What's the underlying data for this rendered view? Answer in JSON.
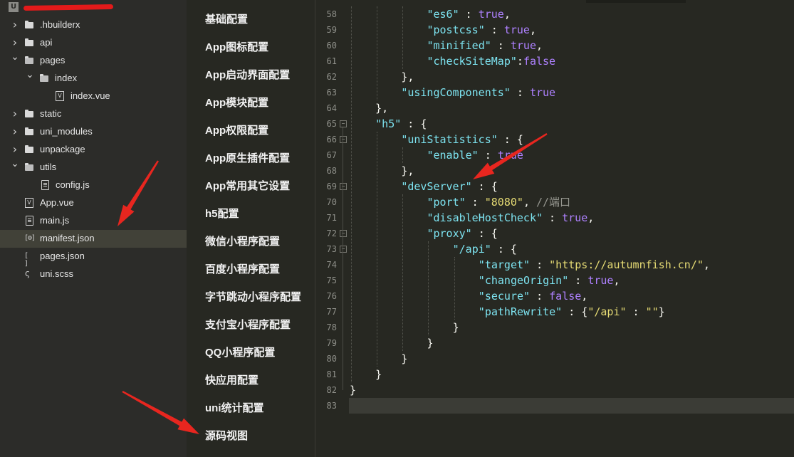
{
  "file_tree": {
    "project_icon": "U",
    "items": [
      {
        "label": ".hbuilderx",
        "type": "folder",
        "expanded": false,
        "indent": 0
      },
      {
        "label": "api",
        "type": "folder",
        "expanded": false,
        "indent": 0
      },
      {
        "label": "pages",
        "type": "folder",
        "expanded": true,
        "indent": 0
      },
      {
        "label": "index",
        "type": "folder",
        "expanded": true,
        "indent": 1
      },
      {
        "label": "index.vue",
        "type": "vue",
        "indent": 2
      },
      {
        "label": "static",
        "type": "folder",
        "expanded": false,
        "indent": 0
      },
      {
        "label": "uni_modules",
        "type": "folder",
        "expanded": false,
        "indent": 0
      },
      {
        "label": "unpackage",
        "type": "folder",
        "expanded": false,
        "indent": 0
      },
      {
        "label": "utils",
        "type": "folder",
        "expanded": true,
        "indent": 0
      },
      {
        "label": "config.js",
        "type": "file",
        "indent": 1
      },
      {
        "label": "App.vue",
        "type": "vue",
        "indent": 0
      },
      {
        "label": "main.js",
        "type": "file",
        "indent": 0
      },
      {
        "label": "manifest.json",
        "type": "manifest",
        "indent": 0,
        "selected": true
      },
      {
        "label": "pages.json",
        "type": "json",
        "indent": 0
      },
      {
        "label": "uni.scss",
        "type": "scss",
        "indent": 0
      }
    ]
  },
  "settings_nav": {
    "items": [
      "基础配置",
      "App图标配置",
      "App启动界面配置",
      "App模块配置",
      "App权限配置",
      "App原生插件配置",
      "App常用其它设置",
      "h5配置",
      "微信小程序配置",
      "百度小程序配置",
      "字节跳动小程序配置",
      "支付宝小程序配置",
      "QQ小程序配置",
      "快应用配置",
      "uni统计配置",
      "源码视图"
    ]
  },
  "editor": {
    "current_line": 83,
    "lines": [
      {
        "n": 58,
        "indent": 3,
        "fold": false,
        "tokens": [
          [
            "key",
            "\"es6\""
          ],
          [
            "punc",
            " : "
          ],
          [
            "kw",
            "true"
          ],
          [
            "punc",
            ","
          ]
        ]
      },
      {
        "n": 59,
        "indent": 3,
        "fold": false,
        "tokens": [
          [
            "key",
            "\"postcss\""
          ],
          [
            "punc",
            " : "
          ],
          [
            "kw",
            "true"
          ],
          [
            "punc",
            ","
          ]
        ]
      },
      {
        "n": 60,
        "indent": 3,
        "fold": false,
        "tokens": [
          [
            "key",
            "\"minified\""
          ],
          [
            "punc",
            " : "
          ],
          [
            "kw",
            "true"
          ],
          [
            "punc",
            ","
          ]
        ]
      },
      {
        "n": 61,
        "indent": 3,
        "fold": false,
        "tokens": [
          [
            "key",
            "\"checkSiteMap\""
          ],
          [
            "punc",
            ":"
          ],
          [
            "kw",
            "false"
          ]
        ]
      },
      {
        "n": 62,
        "indent": 2,
        "fold": false,
        "tokens": [
          [
            "punc",
            "},"
          ]
        ]
      },
      {
        "n": 63,
        "indent": 2,
        "fold": false,
        "tokens": [
          [
            "key",
            "\"usingComponents\""
          ],
          [
            "punc",
            " : "
          ],
          [
            "kw",
            "true"
          ]
        ]
      },
      {
        "n": 64,
        "indent": 1,
        "fold": false,
        "tokens": [
          [
            "punc",
            "},"
          ]
        ]
      },
      {
        "n": 65,
        "indent": 1,
        "fold": true,
        "tokens": [
          [
            "key",
            "\"h5\""
          ],
          [
            "punc",
            " : {"
          ]
        ]
      },
      {
        "n": 66,
        "indent": 2,
        "fold": true,
        "tokens": [
          [
            "key",
            "\"uniStatistics\""
          ],
          [
            "punc",
            " : {"
          ]
        ]
      },
      {
        "n": 67,
        "indent": 3,
        "fold": false,
        "tokens": [
          [
            "key",
            "\"enable\""
          ],
          [
            "punc",
            " : "
          ],
          [
            "kw",
            "true"
          ]
        ]
      },
      {
        "n": 68,
        "indent": 2,
        "fold": false,
        "tokens": [
          [
            "punc",
            "},"
          ]
        ]
      },
      {
        "n": 69,
        "indent": 2,
        "fold": true,
        "tokens": [
          [
            "key",
            "\"devServer\""
          ],
          [
            "punc",
            " : {"
          ]
        ]
      },
      {
        "n": 70,
        "indent": 3,
        "fold": false,
        "tokens": [
          [
            "key",
            "\"port\""
          ],
          [
            "punc",
            " : "
          ],
          [
            "str",
            "\"8080\""
          ],
          [
            "punc",
            ", "
          ],
          [
            "com",
            "//端口"
          ]
        ]
      },
      {
        "n": 71,
        "indent": 3,
        "fold": false,
        "tokens": [
          [
            "key",
            "\"disableHostCheck\""
          ],
          [
            "punc",
            " : "
          ],
          [
            "kw",
            "true"
          ],
          [
            "punc",
            ","
          ]
        ]
      },
      {
        "n": 72,
        "indent": 3,
        "fold": true,
        "tokens": [
          [
            "key",
            "\"proxy\""
          ],
          [
            "punc",
            " : {"
          ]
        ]
      },
      {
        "n": 73,
        "indent": 4,
        "fold": true,
        "tokens": [
          [
            "key",
            "\"/api\""
          ],
          [
            "punc",
            " : {"
          ]
        ]
      },
      {
        "n": 74,
        "indent": 5,
        "fold": false,
        "tokens": [
          [
            "key",
            "\"target\""
          ],
          [
            "punc",
            " : "
          ],
          [
            "str",
            "\"https://autumnfish.cn/\""
          ],
          [
            "punc",
            ","
          ]
        ]
      },
      {
        "n": 75,
        "indent": 5,
        "fold": false,
        "tokens": [
          [
            "key",
            "\"changeOrigin\""
          ],
          [
            "punc",
            " : "
          ],
          [
            "kw",
            "true"
          ],
          [
            "punc",
            ","
          ]
        ]
      },
      {
        "n": 76,
        "indent": 5,
        "fold": false,
        "tokens": [
          [
            "key",
            "\"secure\""
          ],
          [
            "punc",
            " : "
          ],
          [
            "kw",
            "false"
          ],
          [
            "punc",
            ","
          ]
        ]
      },
      {
        "n": 77,
        "indent": 5,
        "fold": false,
        "tokens": [
          [
            "key",
            "\"pathRewrite\""
          ],
          [
            "punc",
            " : {"
          ],
          [
            "str",
            "\"/api\""
          ],
          [
            "punc",
            " : "
          ],
          [
            "str",
            "\"\""
          ],
          [
            "punc",
            "}"
          ]
        ]
      },
      {
        "n": 78,
        "indent": 4,
        "fold": false,
        "tokens": [
          [
            "punc",
            "}"
          ]
        ]
      },
      {
        "n": 79,
        "indent": 3,
        "fold": false,
        "tokens": [
          [
            "punc",
            "}"
          ]
        ]
      },
      {
        "n": 80,
        "indent": 2,
        "fold": false,
        "tokens": [
          [
            "punc",
            "}"
          ]
        ]
      },
      {
        "n": 81,
        "indent": 1,
        "fold": false,
        "tokens": [
          [
            "punc",
            "}"
          ]
        ]
      },
      {
        "n": 82,
        "indent": 0,
        "fold": false,
        "tokens": [
          [
            "punc",
            "}"
          ]
        ]
      },
      {
        "n": 83,
        "indent": 0,
        "fold": false,
        "tokens": []
      }
    ]
  },
  "colors": {
    "annotation_arrow": "#e8261f",
    "json_key": "#7de3f0",
    "json_string": "#e6db74",
    "json_literal": "#ae81ff",
    "comment": "#95968f"
  }
}
